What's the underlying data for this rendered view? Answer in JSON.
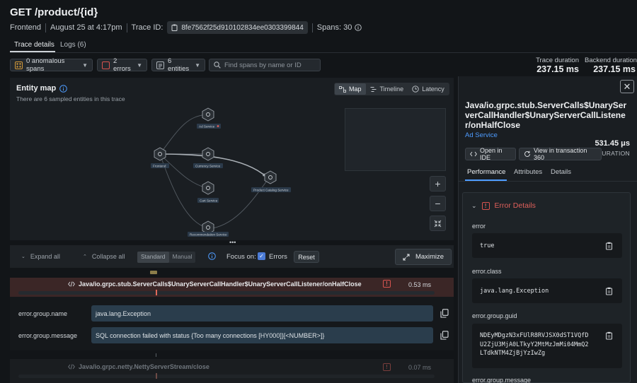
{
  "header": {
    "title": "GET /product/{id}",
    "app": "Frontend",
    "date": "August 25 at 4:17pm",
    "trace_id_label": "Trace ID:",
    "trace_id": "8fe7562f25d910102834ee0303399844",
    "spans_label": "Spans: 30"
  },
  "tabs": [
    {
      "label": "Trace details",
      "active": true
    },
    {
      "label": "Logs (6)",
      "active": false
    }
  ],
  "filters": {
    "anomalous": "0 anomalous spans",
    "errors": "2 errors",
    "entities": "6 entities",
    "search_placeholder": "Find spans by name or ID"
  },
  "durations": {
    "trace_label": "Trace duration",
    "trace_value": "237.15 ms",
    "backend_label": "Backend duration",
    "backend_value": "237.15 ms"
  },
  "entity_map": {
    "title": "Entity map",
    "subtitle": "There are 6 sampled entities in this trace",
    "views": [
      "Map",
      "Timeline",
      "Latency"
    ],
    "active_view": "Map",
    "nodes": [
      "Ad Service",
      "Frontend",
      "Currency Service",
      "Cart Service",
      "Product Catalog Service",
      "Recommendation Service"
    ]
  },
  "span_toolbar": {
    "expand_all": "Expand all",
    "collapse_all": "Collapse all",
    "mode_standard": "Standard",
    "mode_manual": "Manual",
    "focus_on": "Focus on:",
    "errors": "Errors",
    "reset": "Reset",
    "maximize": "Maximize"
  },
  "spans": [
    {
      "name": "Java/io.grpc.stub.ServerCalls$UnaryServerCallHandler$UnaryServerCallListener/onHalfClose",
      "duration": "0.53 ms"
    },
    {
      "name": "Java/io.grpc.netty.NettyServerStream/close",
      "duration": "0.07 ms"
    }
  ],
  "span_attributes": [
    {
      "key": "error.group.name",
      "value": "java.lang.Exception"
    },
    {
      "key": "error.group.message",
      "value": "SQL connection failed with status {Too many connections [HY000]}[<NUMBER>]}"
    }
  ],
  "right_panel": {
    "span_title": "Java/io.grpc.stub.ServerCalls$UnaryServerCallHandler$UnaryServerCallListener/onHalfClose",
    "service": "Ad Service",
    "duration": "531.45 μs",
    "duration_label": "DURATION",
    "open_ide": "Open in IDE",
    "view_360": "View in transaction 360",
    "tabs": [
      "Performance",
      "Attributes",
      "Details"
    ],
    "error_details_title": "Error Details",
    "error_fields": [
      {
        "key": "error",
        "value": "true"
      },
      {
        "key": "error.class",
        "value": "java.lang.Exception"
      },
      {
        "key": "error.group.guid",
        "value": "NDEyMDgzN3xFUlR8RVJSX0dST1VQfDU2ZjU3MjA0LTkyY2MtMzJmMi04MmQ2LTdkNTM4ZjBjYzIwZg"
      },
      {
        "key": "error.group.message",
        "value": ""
      }
    ],
    "guid_lines": [
      "NDEyMDgzN3xFUlR8RVJSX0dST1VQfD",
      "U2ZjU3MjA0LTkyY2MtMzJmMi04MmQ2",
      "LTdkNTM4ZjBjYzIwZg"
    ]
  },
  "colors": {
    "background": "#121518",
    "accent": "#4e9cff",
    "error": "#e0605b",
    "error_row": "#3b2626",
    "attr_value_bg": "#2a3d4c"
  }
}
